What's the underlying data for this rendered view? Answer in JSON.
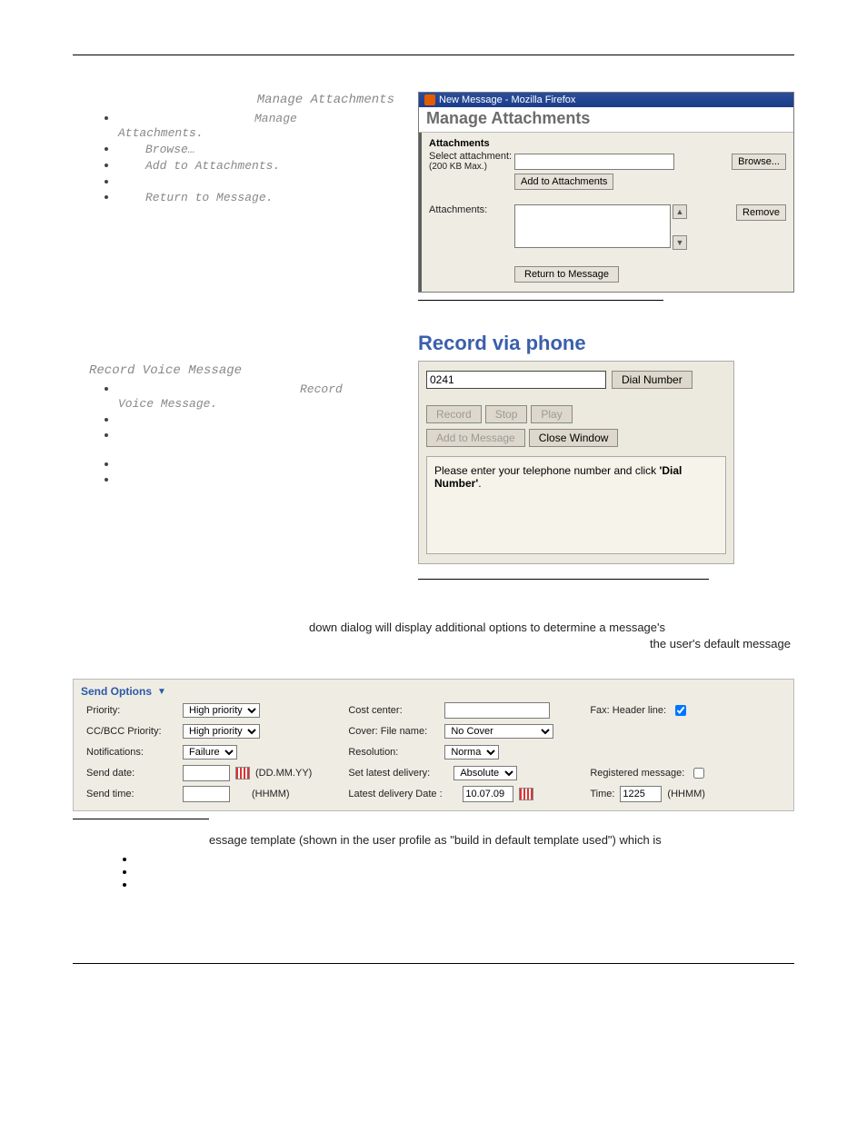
{
  "attachments_section": {
    "title_link": "Manage Attachments",
    "steps": [
      "Manage",
      "Browse…",
      "Add to Attachments.",
      "Return to Message."
    ],
    "step1_suffix": "Attachments."
  },
  "attachments_window": {
    "titlebar": "New Message - Mozilla Firefox",
    "heading": "Manage Attachments",
    "section_label": "Attachments",
    "select_label": "Select attachment:",
    "max_label": "(200 KB Max.)",
    "browse_btn": "Browse...",
    "add_btn": "Add to Attachments",
    "list_label": "Attachments:",
    "remove_btn": "Remove",
    "return_btn": "Return to Message"
  },
  "record_section": {
    "title_link": "Record Voice Message",
    "step1": "Record",
    "step1_suffix": "Voice Message."
  },
  "record_panel": {
    "heading": "Record via phone",
    "phone_value": "0241",
    "dial_btn": "Dial Number",
    "record_btn": "Record",
    "stop_btn": "Stop",
    "play_btn": "Play",
    "add_btn": "Add to Message",
    "close_btn": "Close Window",
    "instruction_pre": "Please enter your telephone number and click ",
    "instruction_bold": "'Dial Number'",
    "instruction_post": "."
  },
  "body_paragraph1": "down dialog will display additional options to determine a message's",
  "body_paragraph1b": "the user's default message",
  "send_options": {
    "title": "Send Options",
    "left": {
      "priority_lbl": "Priority:",
      "priority_val": "High priority",
      "ccbcc_lbl": "CC/BCC Priority:",
      "ccbcc_val": "High priority",
      "notif_lbl": "Notifications:",
      "notif_val": "Failure",
      "sdate_lbl": "Send date:",
      "sdate_hint": "(DD.MM.YY)",
      "stime_lbl": "Send time:",
      "stime_hint": "(HHMM)"
    },
    "mid": {
      "cost_lbl": "Cost center:",
      "cover_lbl": "Cover: File name:",
      "cover_val": "No Cover",
      "res_lbl": "Resolution:",
      "res_val": "Normal",
      "latest_lbl": "Set latest delivery:",
      "latest_val": "Absolute",
      "ldd_lbl": "Latest delivery Date :",
      "ldd_val": "10.07.09"
    },
    "right": {
      "faxhdr_lbl": "Fax: Header line:",
      "reg_lbl": "Registered message:",
      "time_lbl": "Time:",
      "time_val": "1225",
      "time_hint": "(HHMM)"
    }
  },
  "body_paragraph2": "essage template (shown in the user profile as \"build in default template used\") which is"
}
